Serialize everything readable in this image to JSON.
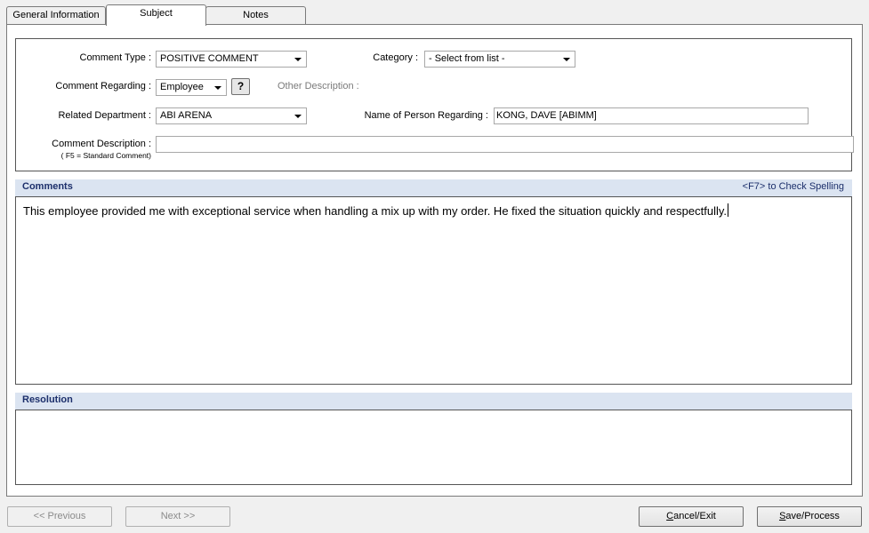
{
  "tabs": {
    "general": "General Information",
    "subject": "Subject",
    "notes": "Notes"
  },
  "form": {
    "comment_type_label": "Comment Type :",
    "comment_type_value": "POSITIVE COMMENT",
    "category_label": "Category :",
    "category_value": "- Select from list -",
    "comment_regarding_label": "Comment Regarding :",
    "comment_regarding_value": "Employee",
    "help_button": "?",
    "other_description_label": "Other Description :",
    "related_department_label": "Related Department :",
    "related_department_value": "ABI ARENA",
    "person_regarding_label": "Name of Person Regarding :",
    "person_regarding_value": "KONG, DAVE [ABIMM]",
    "comment_description_label": "Comment Description :",
    "comment_description_hint": "( F5 = Standard Comment)",
    "comment_description_value": ""
  },
  "comments": {
    "title": "Comments",
    "spell_check_link": "<F7> to Check Spelling",
    "text": "This employee provided me with exceptional service when handling a mix up with my order. He fixed the situation quickly and respectfully."
  },
  "resolution": {
    "title": "Resolution",
    "text": ""
  },
  "buttons": {
    "previous": "<< Previous",
    "next": "Next >>",
    "cancel_first": "C",
    "cancel_rest": "ancel/Exit",
    "save_first": "S",
    "save_rest": "ave/Process"
  }
}
